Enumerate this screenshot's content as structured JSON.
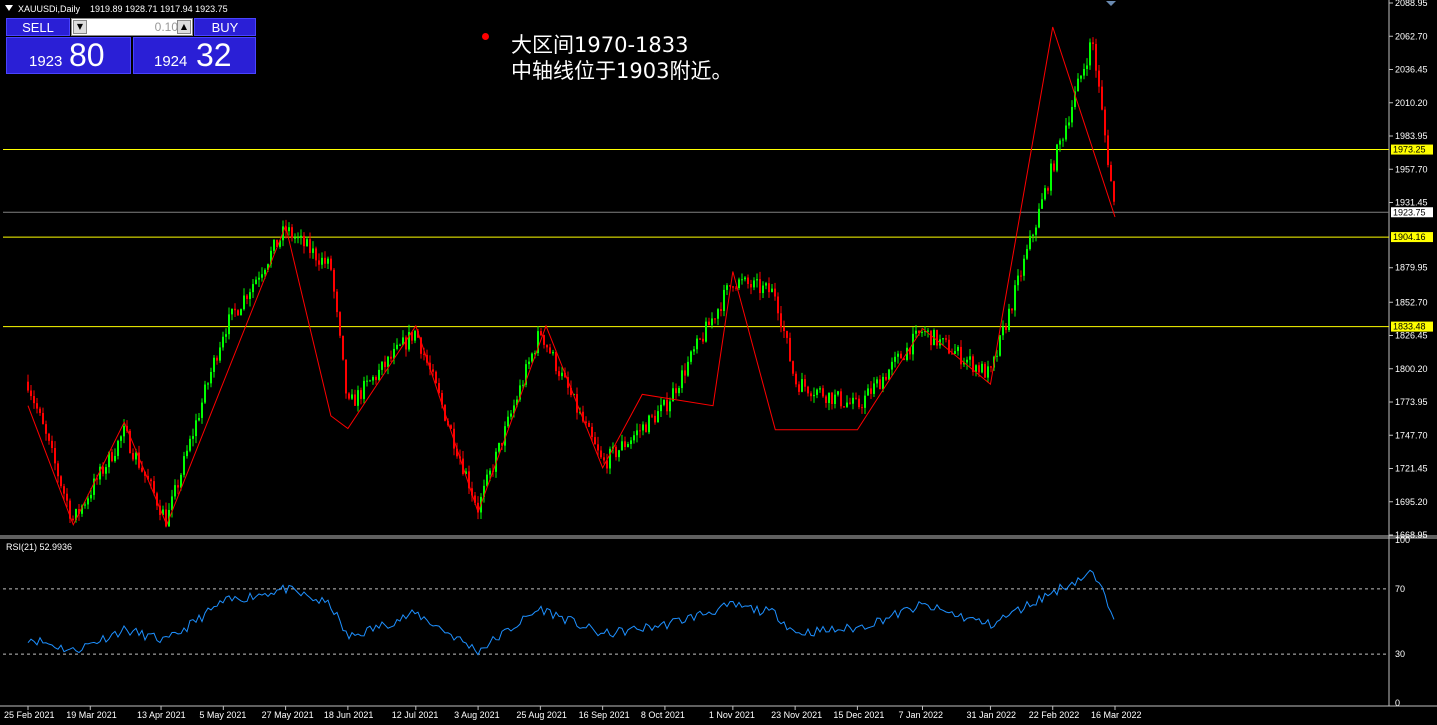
{
  "header": {
    "symbol_title": "XAUUSDi,Daily",
    "ohlc": "1919.89 1928.71 1917.94 1923.75"
  },
  "trade_panel": {
    "sell_label": "SELL",
    "buy_label": "BUY",
    "lot_value": "0.10",
    "sell_price_small": "1923",
    "sell_price_big": "80",
    "buy_price_small": "1924",
    "buy_price_big": "32"
  },
  "annotation": {
    "line1": "大区间1970-1833",
    "line2": "中轴线位于1903附近。"
  },
  "price_axis": {
    "ticks": [
      "2088.95",
      "2062.70",
      "2036.45",
      "2010.20",
      "1983.95",
      "1957.70",
      "1931.45",
      "1879.95",
      "1852.70",
      "1826.45",
      "1800.20",
      "1773.95",
      "1747.70",
      "1721.45",
      "1695.20",
      "1668.95"
    ],
    "labels": [
      {
        "text": "1973.25",
        "price": 1973.25,
        "style": "level"
      },
      {
        "text": "1923.75",
        "price": 1923.75,
        "style": "current"
      },
      {
        "text": "1904.16",
        "price": 1904.16,
        "style": "level"
      },
      {
        "text": "1833.48",
        "price": 1833.48,
        "style": "level"
      }
    ]
  },
  "levels": [
    1973.25,
    1904.16,
    1833.48
  ],
  "current_price": 1923.75,
  "rsi": {
    "title": "RSI(21) 52.9936",
    "ticks": [
      "100",
      "70",
      "30",
      "0"
    ],
    "levels": [
      70,
      30
    ]
  },
  "date_axis": [
    "25 Feb 2021",
    "19 Mar 2021",
    "13 Apr 2021",
    "5 May 2021",
    "27 May 2021",
    "18 Jun 2021",
    "12 Jul 2021",
    "3 Aug 2021",
    "25 Aug 2021",
    "16 Sep 2021",
    "8 Oct 2021",
    "1 Nov 2021",
    "23 Nov 2021",
    "15 Dec 2021",
    "7 Jan 2022",
    "31 Jan 2022",
    "22 Feb 2022",
    "16 Mar 2022"
  ],
  "colors": {
    "bull": "#00ff00",
    "bear": "#ff0000",
    "level_line": "#ffff00",
    "zigzag": "#ff0000",
    "rsi_line": "#1e90ff",
    "grid_axis": "#c0c0c0"
  },
  "chart_data": {
    "type": "line",
    "title": "",
    "xlabel": "",
    "ylabel": "",
    "ylim": [
      1668.95,
      2088.95
    ],
    "zigzag": {
      "x": [
        "25 Feb 2021",
        "13 Mar 2021",
        "31 Mar 2021",
        "15 Apr 2021",
        "27 May 2021",
        "12 Jun 2021",
        "18 Jun 2021",
        "12 Jul 2021",
        "3 Aug 2021",
        "27 Aug 2021",
        "16 Sep 2021",
        "30 Sep 2021",
        "25 Oct 2021",
        "1 Nov 2021",
        "16 Nov 2021",
        "15 Dec 2021",
        "7 Jan 2022",
        "31 Jan 2022",
        "22 Feb 2022",
        "16 Mar 2022"
      ],
      "y": [
        1771,
        1677,
        1758,
        1677,
        1913,
        1763,
        1753,
        1834,
        1687,
        1834,
        1722,
        1780,
        1771,
        1877,
        1752,
        1752,
        1832,
        1788,
        2070,
        1920
      ]
    },
    "price_path": {
      "x": [
        "25 Feb 2021",
        "13 Mar 2021",
        "31 Mar 2021",
        "15 Apr 2021",
        "5 May 2021",
        "27 May 2021",
        "12 Jun 2021",
        "18 Jun 2021",
        "12 Jul 2021",
        "3 Aug 2021",
        "25 Aug 2021",
        "16 Sep 2021",
        "8 Oct 2021",
        "1 Nov 2021",
        "16 Nov 2021",
        "23 Nov 2021",
        "15 Dec 2021",
        "7 Jan 2022",
        "31 Jan 2022",
        "22 Feb 2022",
        "8 Mar 2022",
        "16 Mar 2022"
      ],
      "y": [
        1790,
        1680,
        1750,
        1680,
        1830,
        1910,
        1880,
        1770,
        1830,
        1690,
        1830,
        1725,
        1770,
        1870,
        1860,
        1790,
        1770,
        1830,
        1795,
        1960,
        2060,
        1923.75
      ]
    },
    "rsi_series": {
      "name": "RSI(21)",
      "last_value": 52.9936,
      "x": [
        "25 Feb 2021",
        "13 Mar 2021",
        "31 Mar 2021",
        "15 Apr 2021",
        "5 May 2021",
        "27 May 2021",
        "12 Jun 2021",
        "18 Jun 2021",
        "12 Jul 2021",
        "3 Aug 2021",
        "25 Aug 2021",
        "16 Sep 2021",
        "8 Oct 2021",
        "1 Nov 2021",
        "16 Nov 2021",
        "23 Nov 2021",
        "15 Dec 2021",
        "7 Jan 2022",
        "31 Jan 2022",
        "22 Feb 2022",
        "8 Mar 2022",
        "16 Mar 2022"
      ],
      "y": [
        40,
        32,
        45,
        38,
        62,
        70,
        60,
        40,
        55,
        32,
        58,
        42,
        48,
        60,
        55,
        43,
        46,
        60,
        48,
        68,
        80,
        53
      ]
    }
  }
}
